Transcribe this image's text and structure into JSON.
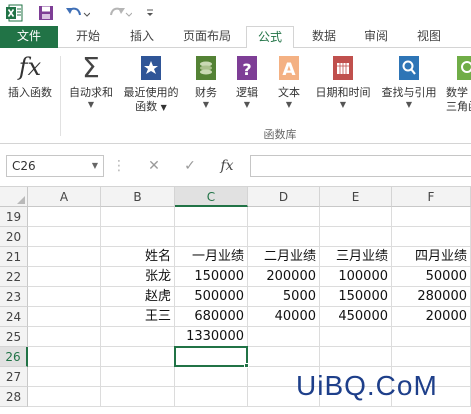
{
  "app": {
    "accent": "#217346",
    "quick_access": [
      "save-icon",
      "undo-icon",
      "redo-icon",
      "customize-icon"
    ]
  },
  "tabs": [
    {
      "label": "文件"
    },
    {
      "label": "开始"
    },
    {
      "label": "插入"
    },
    {
      "label": "页面布局"
    },
    {
      "label": "公式"
    },
    {
      "label": "数据"
    },
    {
      "label": "审阅"
    },
    {
      "label": "视图"
    }
  ],
  "active_tab": "公式",
  "ribbon": {
    "insert_function": "插入函数",
    "autosum": "自动求和",
    "recent_line1": "最近使用的",
    "recent_line2": "函数",
    "financial": "财务",
    "logical": "逻辑",
    "text": "文本",
    "datetime": "日期和时间",
    "lookup": "查找与引用",
    "math_line1": "数学",
    "math_line2": "三角函",
    "group_label": "函数库"
  },
  "formula_bar": {
    "name_box": "C26",
    "fx": "fx",
    "cancel": "✕",
    "enter": "✓",
    "content": ""
  },
  "sheet": {
    "columns": [
      "A",
      "B",
      "C",
      "D",
      "E",
      "F"
    ],
    "selected_column": "C",
    "rows": [
      "19",
      "20",
      "21",
      "22",
      "23",
      "24",
      "25",
      "26",
      "27",
      "28"
    ],
    "selected_row": "26",
    "selected_cell": "C26",
    "cells": {
      "B21": "姓名",
      "C21": "一月业绩",
      "D21": "二月业绩",
      "E21": "三月业绩",
      "F21": "四月业绩",
      "B22": "张龙",
      "C22": "150000",
      "D22": "200000",
      "E22": "100000",
      "F22": "50000",
      "B23": "赵虎",
      "C23": "500000",
      "D23": "5000",
      "E23": "150000",
      "F23": "280000",
      "B24": "王三",
      "C24": "680000",
      "D24": "40000",
      "E24": "450000",
      "F24": "20000",
      "C25": "1330000"
    }
  },
  "watermark": "UiBQ.CoM"
}
